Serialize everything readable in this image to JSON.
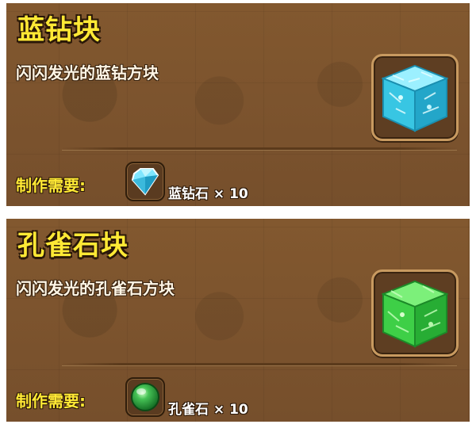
{
  "cards": [
    {
      "title": "蓝钻块",
      "description": "闪闪发光的蓝钻方块",
      "requirement_label": "制作需要:",
      "material_name": "蓝钻石",
      "material_count": "× 10",
      "block_icon": "blue-diamond-block-icon",
      "material_icon": "blue-diamond-gem-icon",
      "color": "#37c9e6"
    },
    {
      "title": "孔雀石块",
      "description": "闪闪发光的孔雀石方块",
      "requirement_label": "制作需要:",
      "material_name": "孔雀石",
      "material_count": "× 10",
      "block_icon": "malachite-block-icon",
      "material_icon": "malachite-orb-icon",
      "color": "#3fd24a"
    }
  ]
}
